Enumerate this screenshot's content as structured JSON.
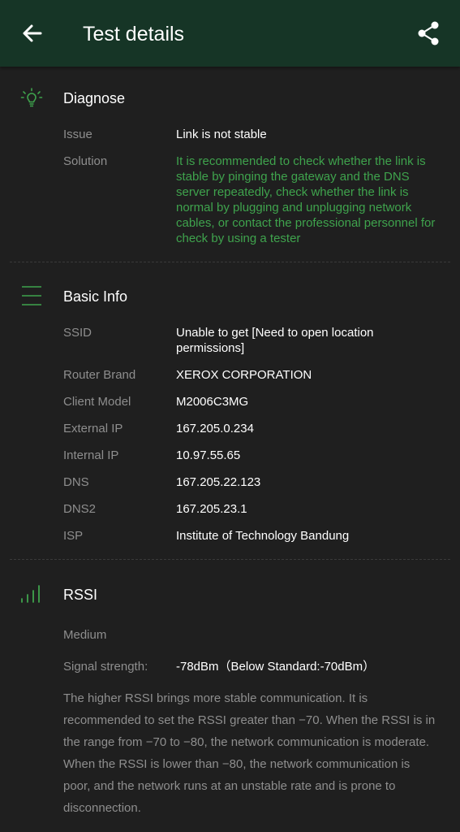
{
  "header": {
    "title": "Test details",
    "bg_color": "#163526",
    "back_icon": "arrow-left",
    "share_icon": "share"
  },
  "diagnose": {
    "title": "Diagnose",
    "icon": "lightbulb",
    "issue_label": "Issue",
    "issue_value": "Link is not stable",
    "solution_label": "Solution",
    "solution_value": "It is recommended to check whether the link is stable by pinging the gateway and the DNS server repeatedly, check whether the link is normal by plugging and unplugging network cables, or contact the professional personnel for check by using a tester",
    "solution_color": "#3fa34d"
  },
  "basic_info": {
    "title": "Basic Info",
    "icon": "menu-lines",
    "rows": [
      {
        "label": "SSID",
        "value": "Unable to get [Need to open location permissions]"
      },
      {
        "label": "Router Brand",
        "value": "XEROX CORPORATION"
      },
      {
        "label": "Client Model",
        "value": "M2006C3MG"
      },
      {
        "label": "External IP",
        "value": "167.205.0.234"
      },
      {
        "label": "Internal IP",
        "value": "10.97.55.65"
      },
      {
        "label": "DNS",
        "value": "167.205.22.123"
      },
      {
        "label": "DNS2",
        "value": "167.205.23.1"
      },
      {
        "label": "ISP",
        "value": "Institute of Technology Bandung"
      }
    ]
  },
  "rssi": {
    "title": "RSSI",
    "icon": "signal-bars",
    "level": "Medium",
    "strength_label": "Signal strength:",
    "strength_value": "-78dBm（Below Standard:-70dBm）",
    "note": "The higher RSSI brings more stable communication. It is recommended to set the RSSI greater than −70. When the RSSI is in the range from −70 to −80, the network communication is moderate. When the RSSI is lower than −80, the network communication is poor, and the network runs at an unstable rate and is prone to disconnection."
  },
  "accent_color": "#3fa34d"
}
